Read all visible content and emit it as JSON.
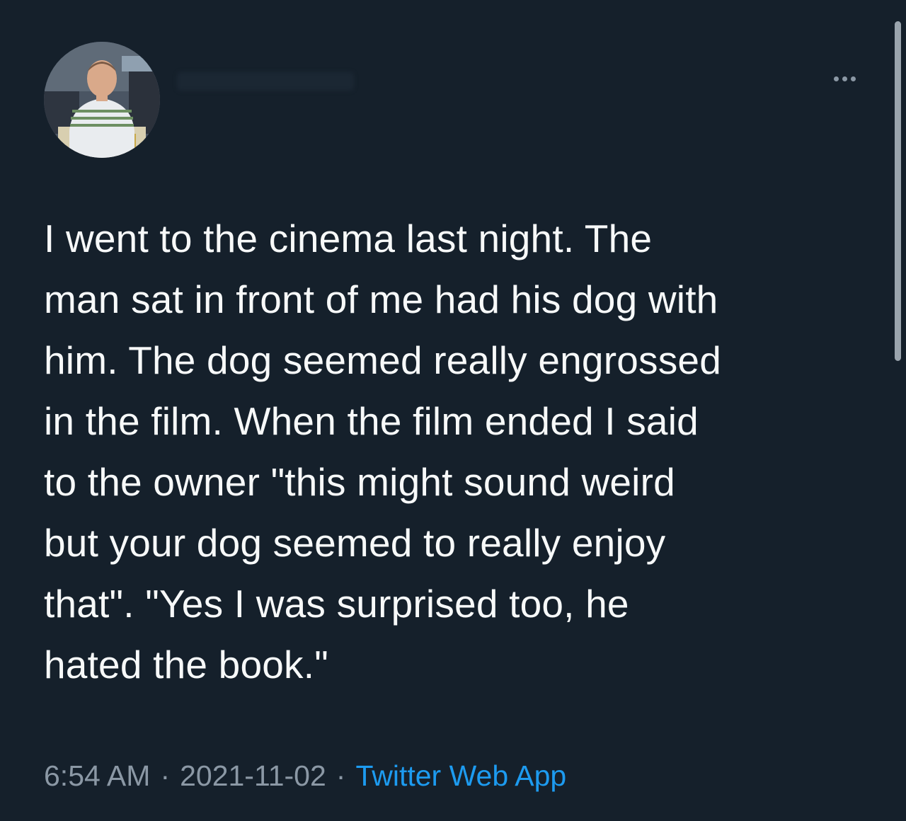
{
  "tweet": {
    "text": "I went to the cinema last night. The\nman sat in front of me had his dog with\nhim. The dog seemed really engrossed\nin the film. When the film ended I said\nto the owner \"this might sound weird\nbut your dog seemed to really enjoy\nthat\". \"Yes I was surprised too, he\nhated the book.\"",
    "time": "6:54 AM",
    "date": "2021-11-02",
    "separator": "·",
    "source": "Twitter Web App"
  },
  "icons": {
    "more": "more-horizontal-icon"
  },
  "colors": {
    "background": "#15202b",
    "text": "#f7f9f9",
    "muted": "#8b98a5",
    "link": "#1d9bf0"
  },
  "scroll": {
    "thumb_fraction": 0.41
  }
}
